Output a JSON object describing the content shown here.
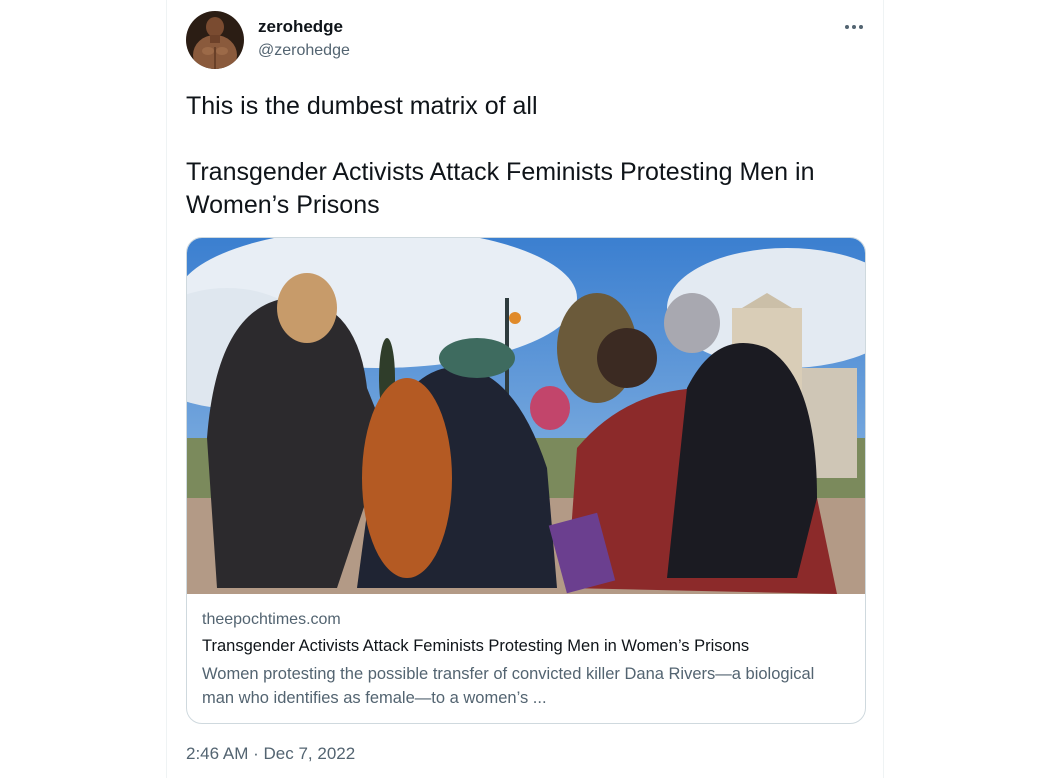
{
  "author": {
    "display_name": "zerohedge",
    "handle": "@zerohedge",
    "avatar_icon": "profile-avatar"
  },
  "tweet": {
    "text": "This is the dumbest matrix of all\n\nTransgender Activists Attack Feminists Protesting Men in Women’s Prisons",
    "more_icon": "more-horizontal-icon"
  },
  "link_card": {
    "domain": "theepochtimes.com",
    "title": "Transgender Activists Attack Feminists Protesting Men in Women’s Prisons",
    "description": "Women protesting the possible transfer of convicted killer Dana Rivers—a biological man who identifies as female—to a women’s ...",
    "image_icon": "article-photo"
  },
  "meta": {
    "time": "2:46 AM",
    "separator": "·",
    "date": "Dec 7, 2022"
  },
  "colors": {
    "text_primary": "#0f1419",
    "text_secondary": "#536471",
    "border": "#cfd9de"
  }
}
